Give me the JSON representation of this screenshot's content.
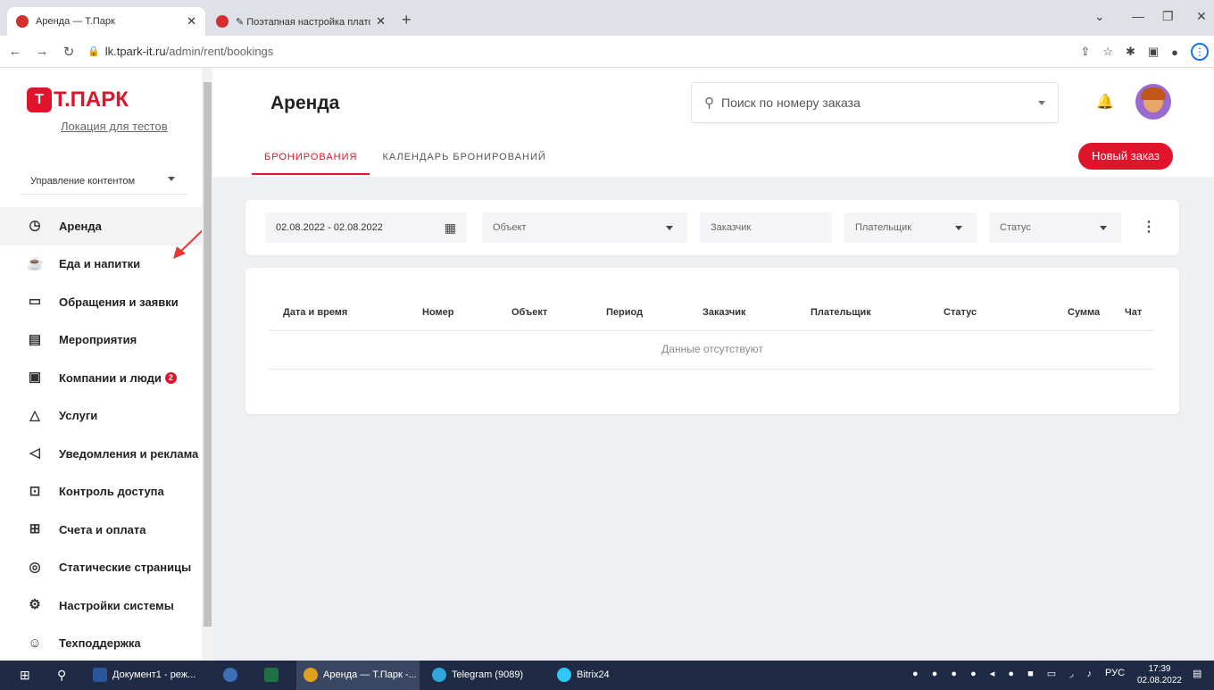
{
  "browser": {
    "tabs": [
      {
        "title": "Аренда — Т.Парк"
      },
      {
        "title": "✎ Поэтапная настройка платф"
      }
    ],
    "url_host": "lk.tpark-it.ru",
    "url_path": "/admin/rent/bookings"
  },
  "sidebar": {
    "logo": "Т.ПАРК",
    "location": "Локация для тестов",
    "content_select": "Управление контентом",
    "items": [
      {
        "label": "Аренда",
        "icon": "calendar-clock-icon"
      },
      {
        "label": "Еда и напитки",
        "icon": "cup-icon"
      },
      {
        "label": "Обращения и заявки",
        "icon": "chat-icon"
      },
      {
        "label": "Мероприятия",
        "icon": "event-icon"
      },
      {
        "label": "Компании и люди",
        "icon": "folder-user-icon",
        "badge": "2"
      },
      {
        "label": "Услуги",
        "icon": "shapes-icon"
      },
      {
        "label": "Уведомления и реклама",
        "icon": "megaphone-icon"
      },
      {
        "label": "Контроль доступа",
        "icon": "lock-icon"
      },
      {
        "label": "Счета и оплата",
        "icon": "calculator-icon"
      },
      {
        "label": "Статические страницы",
        "icon": "page-icon"
      },
      {
        "label": "Настройки системы",
        "icon": "gear-icon"
      },
      {
        "label": "Техподдержка",
        "icon": "support-icon"
      }
    ]
  },
  "header": {
    "title": "Аренда",
    "search_placeholder": "Поиск по номеру заказа",
    "tabs": [
      "БРОНИРОВАНИЯ",
      "КАЛЕНДАРЬ БРОНИРОВАНИЙ"
    ],
    "new_order": "Новый заказ"
  },
  "filters": {
    "date_range": "02.08.2022 - 02.08.2022",
    "object": "Объект",
    "customer": "Заказчик",
    "payer": "Плательщик",
    "status": "Статус"
  },
  "table": {
    "columns": [
      "Дата и время",
      "Номер",
      "Объект",
      "Период",
      "Заказчик",
      "Плательщик",
      "Статус",
      "Сумма",
      "Чат"
    ],
    "empty": "Данные отсутствуют"
  },
  "taskbar": {
    "items": [
      "Документ1 - реж...",
      "Аренда — Т.Парк -...",
      "Telegram (9089)",
      "Bitrix24"
    ],
    "lang": "РУС",
    "time": "17:39",
    "date": "02.08.2022"
  },
  "colors": {
    "accent": "#e0142a"
  }
}
